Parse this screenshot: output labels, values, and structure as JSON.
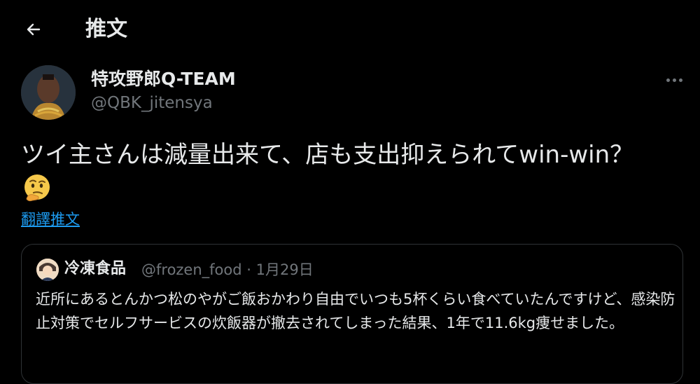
{
  "header": {
    "back_icon": "arrow-left-icon",
    "title": "推文"
  },
  "author": {
    "name": "特攻野郎Q-TEAM",
    "handle": "@QBK_jitensya",
    "avatar_icon": "user-avatar",
    "more_icon": "more-horizontal-icon"
  },
  "tweet": {
    "text": "ツイ主さんは減量出来て、店も支出抑えられてwin-win？",
    "emoji": "thinking-face-emoji",
    "translate_label": "翻譯推文"
  },
  "quote": {
    "name": "冷凍食品",
    "handle": "@frozen_food",
    "separator": "·",
    "date": "1月29日",
    "text": "近所にあるとんかつ松のやがご飯おかわり自由でいつも5杯くらい食べていたんですけど、感染防止対策でセルフサービスの炊飯器が撤去されてしまった結果、1年で11.6kg痩せました。"
  },
  "colors": {
    "background": "#000000",
    "text": "#e7e9ea",
    "secondary": "#71767b",
    "link": "#1d9bf0",
    "border": "#2f3336"
  }
}
